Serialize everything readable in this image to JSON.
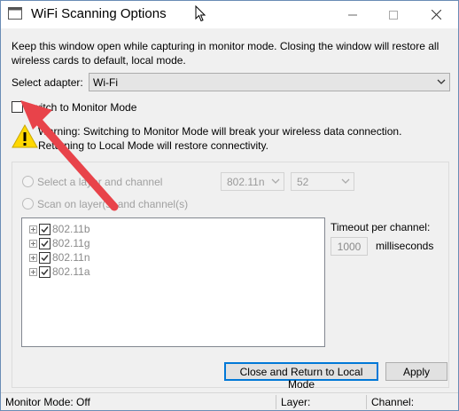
{
  "window": {
    "title": "WiFi Scanning Options"
  },
  "description": "Keep this window open while capturing in monitor mode. Closing the window will restore all wireless cards to default, local mode.",
  "adapter": {
    "label": "Select adapter:",
    "value": "Wi-Fi"
  },
  "monitor_mode": {
    "label": "Switch to Monitor Mode",
    "checked": false
  },
  "warning": {
    "text": "Warning: Switching to Monitor Mode will break your wireless data connection. Returning to Local Mode will restore connectivity."
  },
  "scan_options": {
    "option1_label": "Select a layer and channel",
    "option2_label": "Scan on layer(s) and channel(s)",
    "layer_value": "802.11n",
    "channel_value": "52"
  },
  "layers": [
    {
      "label": "802.11b",
      "checked": true
    },
    {
      "label": "802.11g",
      "checked": true
    },
    {
      "label": "802.11n",
      "checked": true
    },
    {
      "label": "802.11a",
      "checked": true
    }
  ],
  "timeout": {
    "label": "Timeout per channel:",
    "value": "1000",
    "unit": "milliseconds"
  },
  "buttons": {
    "close_return": "Close and Return to Local Mode",
    "apply": "Apply"
  },
  "status": {
    "monitor_mode": "Monitor Mode: Off",
    "layer": "Layer:",
    "channel": "Channel:"
  },
  "colors": {
    "annotation_arrow": "#e8434a",
    "warning_yellow": "#ffd800",
    "focus_border": "#0078d7"
  }
}
